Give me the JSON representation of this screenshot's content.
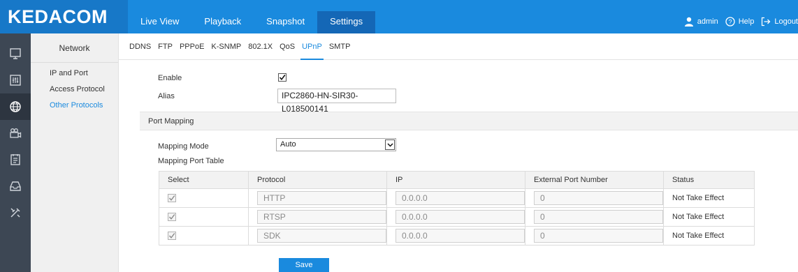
{
  "brand": {
    "logo_text": "KEDACOM"
  },
  "nav": {
    "tabs": [
      {
        "label": "Live View"
      },
      {
        "label": "Playback"
      },
      {
        "label": "Snapshot"
      },
      {
        "label": "Settings",
        "active": true
      }
    ]
  },
  "user": {
    "name": "admin",
    "help_label": "Help",
    "logout_label": "Logout"
  },
  "rail": {
    "items": [
      "monitor-icon",
      "sliders-icon",
      "network-globe-icon",
      "camera-icon",
      "document-icon",
      "storage-icon",
      "tools-icon"
    ],
    "active_index": 2
  },
  "submenu": {
    "title": "Network",
    "items": [
      {
        "label": "IP and Port"
      },
      {
        "label": "Access Protocol"
      },
      {
        "label": "Other Protocols",
        "active": true
      }
    ]
  },
  "subtabs": {
    "items": [
      "DDNS",
      "FTP",
      "PPPoE",
      "K-SNMP",
      "802.1X",
      "QoS",
      "UPnP",
      "SMTP"
    ],
    "active": "UPnP"
  },
  "form": {
    "enable_label": "Enable",
    "enable_checked": true,
    "alias_label": "Alias",
    "alias_value": "IPC2860-HN-SIR30-L018500141",
    "section_title": "Port Mapping",
    "mapping_mode_label": "Mapping Mode",
    "mapping_mode_value": "Auto",
    "table_title": "Mapping Port Table"
  },
  "port_table": {
    "headers": [
      "Select",
      "Protocol",
      "IP",
      "External Port Number",
      "Status"
    ],
    "rows": [
      {
        "selected": true,
        "protocol": "HTTP",
        "ip": "0.0.0.0",
        "port": "0",
        "status": "Not Take Effect"
      },
      {
        "selected": true,
        "protocol": "RTSP",
        "ip": "0.0.0.0",
        "port": "0",
        "status": "Not Take Effect"
      },
      {
        "selected": true,
        "protocol": "SDK",
        "ip": "0.0.0.0",
        "port": "0",
        "status": "Not Take Effect"
      }
    ]
  },
  "actions": {
    "save_label": "Save"
  },
  "colors": {
    "accent": "#1a8ade",
    "rail_bg": "#3d4754",
    "logo_bg": "#1778c8"
  }
}
